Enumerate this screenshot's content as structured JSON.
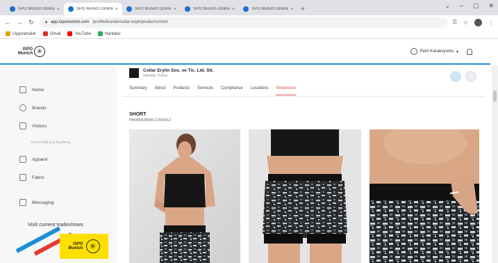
{
  "browser": {
    "tabs": [
      {
        "label": "SPO Munich Online"
      },
      {
        "label": "SPO Munich Online"
      },
      {
        "label": "SPO Munich Online"
      },
      {
        "label": "SPO Munich Online"
      },
      {
        "label": "SPO Munich Online"
      }
    ],
    "url_host": "app.ispomunich.com",
    "url_path": "/profile/brands/collar-eryln/products/short",
    "bookmarks": [
      {
        "label": "Uygulamalar",
        "color": "#e0a400"
      },
      {
        "label": "Gmail",
        "color": "#d93025"
      },
      {
        "label": "YouTube",
        "color": "#ff0000"
      },
      {
        "label": "Haritalar",
        "color": "#34a853"
      }
    ]
  },
  "header": {
    "logo_text_top": "ISPO",
    "logo_text_bottom": "Munich",
    "user_name": "Pelin Karakoyunlu"
  },
  "sidebar": {
    "items": [
      {
        "label": "Home",
        "icon": "home-icon"
      },
      {
        "label": "Brands",
        "icon": "tag-icon"
      },
      {
        "label": "Visitors",
        "icon": "people-icon"
      },
      {
        "label": "Apparel",
        "icon": "shirt-icon"
      },
      {
        "label": "Fabric",
        "icon": "fabric-icon"
      },
      {
        "label": "Messaging",
        "icon": "chat-icon"
      }
    ],
    "sub_label": "Trend briefing & Academy",
    "visit_label": "Visit current tradeshows"
  },
  "company": {
    "name": "Collar Erylin Sos. ve Tic. Ltd. Sti.",
    "country": "Istanbul, Turkey"
  },
  "subtabs": [
    {
      "label": "Summary",
      "active": false
    },
    {
      "label": "About",
      "active": false
    },
    {
      "label": "Products",
      "active": false
    },
    {
      "label": "Services",
      "active": false
    },
    {
      "label": "Compliance",
      "active": false
    },
    {
      "label": "Locations",
      "active": false
    },
    {
      "label": "Showroom",
      "active": true
    }
  ],
  "product": {
    "title": "SHORT",
    "code": "PANNW28095-C39H012"
  },
  "colors": {
    "accent": "#2b8fd6",
    "active_tab": "#d9534f",
    "promo_yellow": "#ffe000"
  }
}
